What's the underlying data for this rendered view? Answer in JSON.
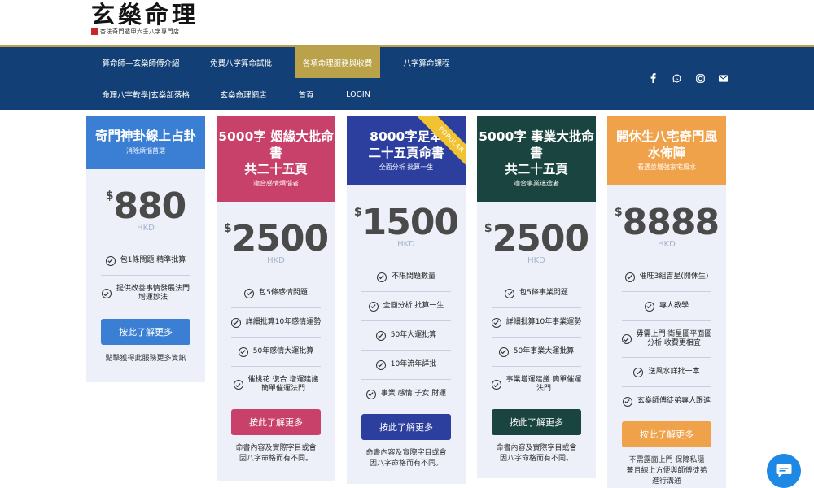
{
  "logo": {
    "main": "玄燊命理",
    "subtitle": "杏法奇門遁甲六壬八字專門店"
  },
  "nav": {
    "row1": [
      "算命師—玄燊師傅介紹",
      "免費八字算命試批",
      "各項命理服務與收費",
      "八字算命課程"
    ],
    "row2": [
      "命理八字教學|玄燊部落格",
      "玄燊命理網店",
      "首頁",
      "LOGIN"
    ],
    "active": "各項命理服務與收費",
    "social_icons": [
      "facebook-icon",
      "whatsapp-icon",
      "instagram-icon",
      "email-icon"
    ]
  },
  "colors": {
    "nav_bg": "#124076",
    "gold": "#b9a24a",
    "card_bg": "#edf0f9",
    "blue_header": "#3b7fd4",
    "pink_header": "#c8416b",
    "indigo_header": "#2c3f9e",
    "green_header": "#1a443f",
    "orange_header": "#f0a24a",
    "popular_ribbon": "#f1c232"
  },
  "cards": [
    {
      "title": "奇門神卦線上占卦",
      "subtitle": "消除煩惱首選",
      "currency": "$",
      "price": "880",
      "unit": "HKD",
      "features": [
        "包1條問題 精準批算",
        "提供改善事情發展法門\n增運妙法"
      ],
      "button": "按此了解更多",
      "note": "點擊獲得此服務更多資訊"
    },
    {
      "title": "5000字 姻緣大批命書\n共二十五頁",
      "subtitle": "適合感情煩惱者",
      "currency": "$",
      "price": "2500",
      "unit": "HKD",
      "features": [
        "包5條感情問題",
        "詳細批算10年感情運勢",
        "50年感情大運批算",
        "催桃花 復合 增運建議\n簡單催運法門"
      ],
      "button": "按此了解更多",
      "note": "命書內容及實際字目或會\n因八字命格而有不同。"
    },
    {
      "title": "8000字足本\n二十五頁命書",
      "subtitle": "全面分析 批算一生",
      "badge": "POPULAR",
      "currency": "$",
      "price": "1500",
      "unit": "HKD",
      "features": [
        "不限問題數量",
        "全面分析 批算一生",
        "50年大運批算",
        "10年流年詳批",
        "事業 感情 子女 財運"
      ],
      "button": "按此了解更多",
      "note": "命書內容及實際字目或會\n因八字命格而有不同。"
    },
    {
      "title": "5000字 事業大批命書\n共二十五頁",
      "subtitle": "適合事業迷途者",
      "currency": "$",
      "price": "2500",
      "unit": "HKD",
      "features": [
        "包5條事業問題",
        "詳細批算10年事業運勢",
        "50年事業大運批算",
        "事業增運建議 簡單催運\n法門"
      ],
      "button": "按此了解更多",
      "note": "命書內容及實際字目或會\n因八字命格而有不同。"
    },
    {
      "title": "開休生八宅奇門風水佈陣",
      "subtitle": "看透並增強家宅風水",
      "currency": "$",
      "price": "8888",
      "unit": "HKD",
      "features": [
        "催旺3組吉星(開休生)",
        "專人教學",
        "毋需上門 衛星圖平面圖\n分析 收費更相宜",
        "送風水詳批一本",
        "玄燊師傅徒弟專人跟進"
      ],
      "button": "按此了解更多",
      "note": "不需露面上門 保障私隱\n兼且線上方便與師傅徒弟\n進行溝通"
    }
  ]
}
